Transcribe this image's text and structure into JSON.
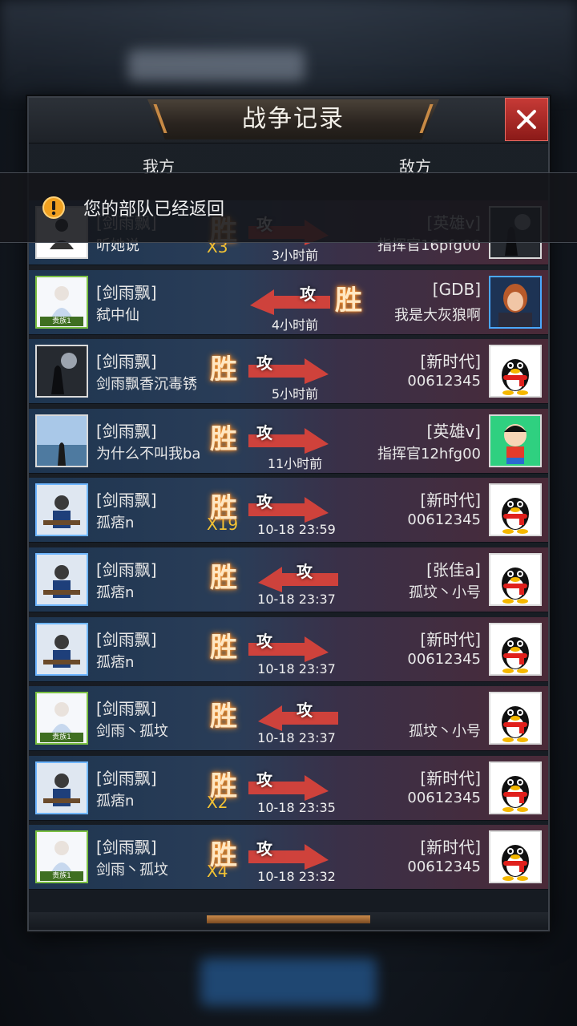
{
  "dialog": {
    "title": "战争记录",
    "close_icon": "close-icon",
    "col_me": "我方",
    "col_enemy": "敌方"
  },
  "notice": {
    "icon": "alert-icon",
    "text": "您的部队已经返回"
  },
  "labels": {
    "win": "胜",
    "attack": "攻"
  },
  "rows": [
    {
      "guild_l": "[剑雨飘]",
      "name_l": "听她说",
      "guild_r": "[英雄v]",
      "name_r": "指挥官16pfg00",
      "time": "3小时前",
      "mult": "X3",
      "win_side": "left",
      "arrow": "right",
      "avatar_l": "white",
      "avatar_r": "dark"
    },
    {
      "guild_l": "[剑雨飘]",
      "name_l": "弑中仙",
      "guild_r": "[GDB]",
      "name_r": "我是大灰狼啊",
      "time": "4小时前",
      "mult": "",
      "win_side": "right",
      "arrow": "left",
      "avatar_l": "green",
      "avatar_r": "hero",
      "tier_l": "贵族1"
    },
    {
      "guild_l": "[剑雨飘]",
      "name_l": "剑雨飘香沉毒锈",
      "guild_r": "[新时代]",
      "name_r": "00612345",
      "time": "5小时前",
      "mult": "",
      "win_side": "left",
      "arrow": "right",
      "avatar_l": "dark",
      "avatar_r": "qq"
    },
    {
      "guild_l": "[剑雨飘]",
      "name_l": "为什么不叫我ba",
      "guild_r": "[英雄v]",
      "name_r": "指挥官12hfg00",
      "time": "11小时前",
      "mult": "",
      "win_side": "left",
      "arrow": "right",
      "avatar_l": "sky",
      "avatar_r": "cartoon"
    },
    {
      "guild_l": "[剑雨飘]",
      "name_l": "孤痞n",
      "guild_r": "[新时代]",
      "name_r": "00612345",
      "time": "10-18 23:59",
      "mult": "X19",
      "win_side": "left",
      "arrow": "right",
      "avatar_l": "blue",
      "avatar_r": "qq"
    },
    {
      "guild_l": "[剑雨飘]",
      "name_l": "孤痞n",
      "guild_r": "[张佳a]",
      "name_r": "孤坟丶小号",
      "time": "10-18 23:37",
      "mult": "",
      "win_side": "left",
      "arrow": "left",
      "avatar_l": "blue",
      "avatar_r": "qq"
    },
    {
      "guild_l": "[剑雨飘]",
      "name_l": "孤痞n",
      "guild_r": "[新时代]",
      "name_r": "00612345",
      "time": "10-18 23:37",
      "mult": "",
      "win_side": "left",
      "arrow": "right",
      "avatar_l": "blue",
      "avatar_r": "qq"
    },
    {
      "guild_l": "[剑雨飘]",
      "name_l": "剑雨丶孤坟",
      "guild_r": "",
      "name_r": "孤坟丶小号",
      "time": "10-18 23:37",
      "mult": "",
      "win_side": "left",
      "arrow": "left",
      "avatar_l": "green",
      "avatar_r": "qq",
      "tier_l": "贵族1"
    },
    {
      "guild_l": "[剑雨飘]",
      "name_l": "孤痞n",
      "guild_r": "[新时代]",
      "name_r": "00612345",
      "time": "10-18 23:35",
      "mult": "X2",
      "win_side": "left",
      "arrow": "right",
      "avatar_l": "blue",
      "avatar_r": "qq"
    },
    {
      "guild_l": "[剑雨飘]",
      "name_l": "剑雨丶孤坟",
      "guild_r": "[新时代]",
      "name_r": "00612345",
      "time": "10-18 23:32",
      "mult": "X4",
      "win_side": "left",
      "arrow": "right",
      "avatar_l": "green",
      "avatar_r": "qq",
      "tier_l": "贵族1"
    }
  ],
  "colors": {
    "accent_red": "#c63a36",
    "win_glow": "#ff9a2a",
    "mult_gold": "#f2c335",
    "arrow_red": "#e0443a"
  }
}
